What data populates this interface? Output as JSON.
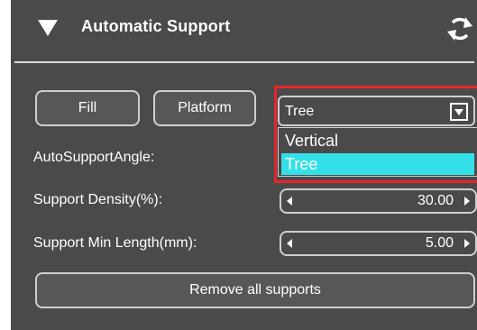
{
  "panel": {
    "title": "Automatic Support",
    "collapse_icon": "triangle-down-icon",
    "refresh_icon": "refresh-icon"
  },
  "buttons": {
    "fill_label": "Fill",
    "platform_label": "Platform",
    "remove_all_label": "Remove all supports"
  },
  "support_type": {
    "selected": "Tree",
    "options": [
      "Vertical",
      "Tree"
    ],
    "dropdown_open": true
  },
  "fields": {
    "auto_support_angle_label": "AutoSupportAngle:",
    "support_density_label": "Support Density(%):",
    "support_density_value": "30.00",
    "support_min_length_label": "Support Min Length(mm):",
    "support_min_length_value": "5.00"
  },
  "colors": {
    "panel_bg": "#4a4a4a",
    "border": "#cfcfcf",
    "selected_item": "#33e0e8",
    "highlight": "#e8242c"
  }
}
